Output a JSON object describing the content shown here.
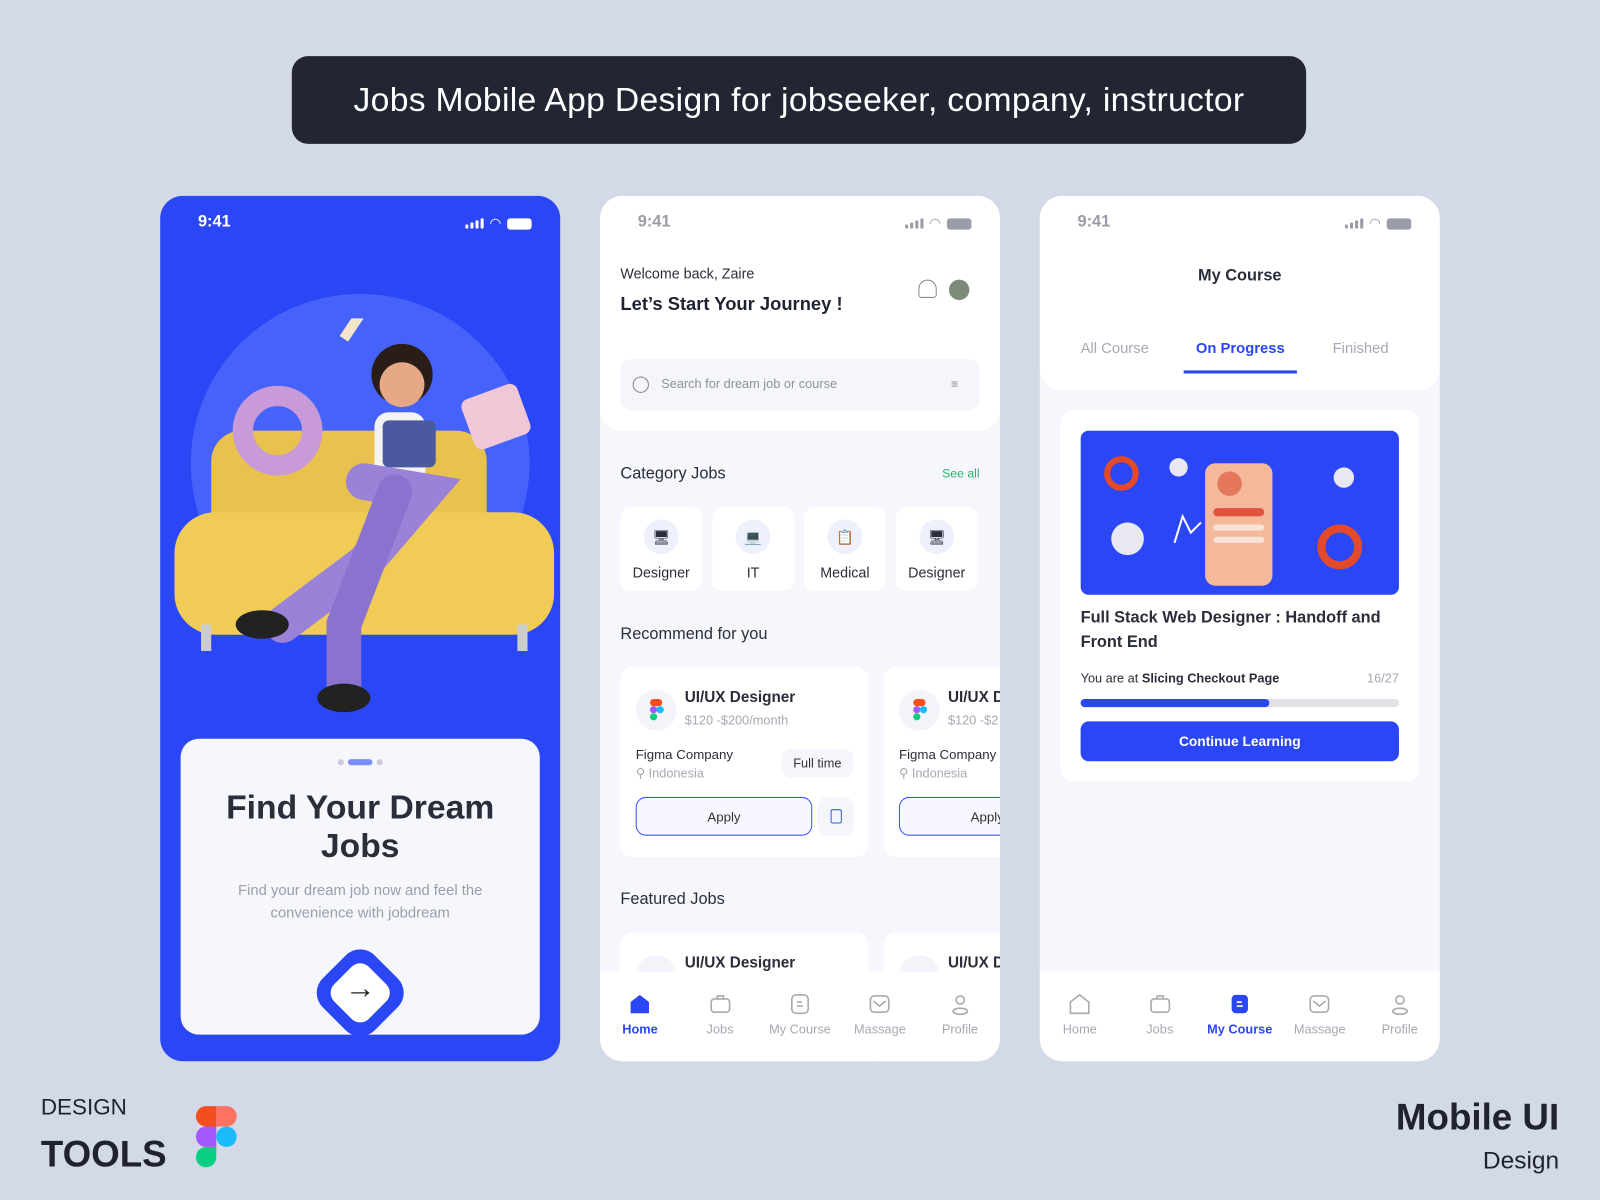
{
  "banner": {
    "title": "Jobs Mobile App Design for jobseeker, company, instructor"
  },
  "status": {
    "time": "9:41"
  },
  "onboarding": {
    "title": "Find Your Dream Jobs",
    "subtitle": "Find your dream job now and feel the convenience with jobdream",
    "page_indicator": {
      "current": 2,
      "total": 3
    }
  },
  "home": {
    "greeting": "Welcome back, Zaire",
    "headline": "Let’s Start Your Journey !",
    "search_placeholder": "Search for dream job or course",
    "category_title": "Category Jobs",
    "see_all": "See all",
    "categories": [
      {
        "label": "Designer"
      },
      {
        "label": "IT"
      },
      {
        "label": "Medical"
      },
      {
        "label": "Designer"
      }
    ],
    "recommend_title": "Recommend for you",
    "jobs": [
      {
        "title": "UI/UX Designer",
        "salary": "$120 -$200/month",
        "company": "Figma Company",
        "location": "Indonesia",
        "type": "Full time",
        "apply": "Apply"
      },
      {
        "title": "UI/UX D",
        "salary": "$120 -$2",
        "company": "Figma Company",
        "location": "Indonesia",
        "apply": "Apply"
      }
    ],
    "featured_title": "Featured Jobs",
    "featured": [
      {
        "title": "UI/UX Designer"
      },
      {
        "title": "UI/UX D"
      }
    ]
  },
  "nav": [
    {
      "label": "Home"
    },
    {
      "label": "Jobs"
    },
    {
      "label": "My Course"
    },
    {
      "label": "Massage"
    },
    {
      "label": "Profile"
    }
  ],
  "course": {
    "title": "My Course",
    "tabs": [
      {
        "label": "All Course"
      },
      {
        "label": "On Progress",
        "active": true
      },
      {
        "label": "Finished"
      }
    ],
    "card": {
      "name": "Full Stack Web Designer : Handoff and Front End",
      "progress_prefix": "You are at",
      "progress_lesson": "Slicing Checkout Page",
      "progress_count": "16/27",
      "progress_fraction": 0.593,
      "button": "Continue Learning"
    }
  },
  "footer": {
    "design": "DESIGN",
    "tools": "TOOLS",
    "mobile_ui": "Mobile UI",
    "design_word": "Design"
  },
  "colors": {
    "primary": "#2a46f5",
    "background": "#d3d9e6",
    "banner": "#222633"
  }
}
